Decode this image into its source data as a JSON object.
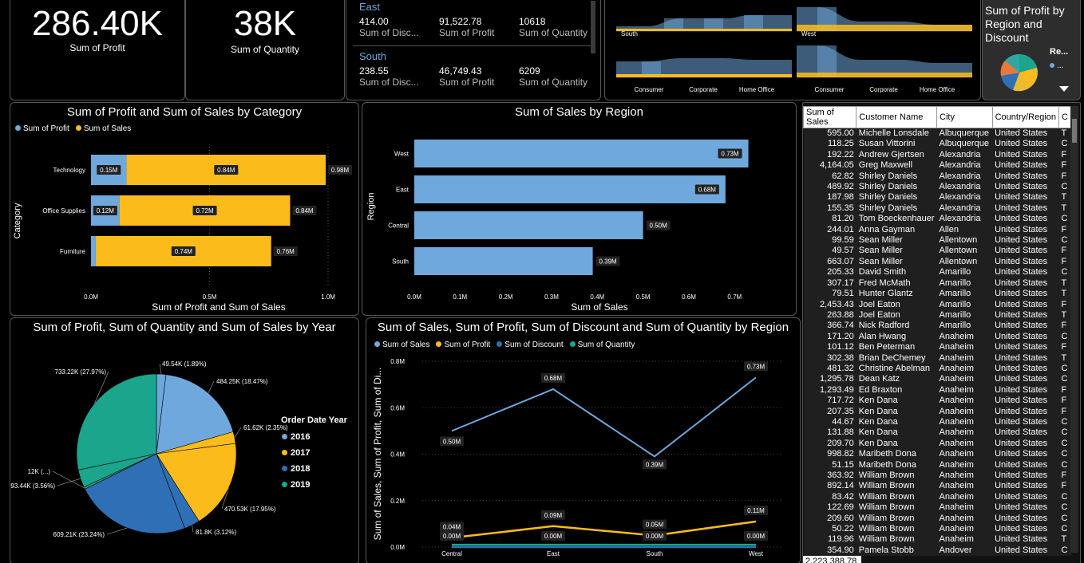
{
  "kpi": {
    "profit": {
      "value": "286.40K",
      "label": "Sum of Profit"
    },
    "quantity": {
      "value": "38K",
      "label": "Sum of Quantity"
    }
  },
  "multirow": [
    {
      "region": "East",
      "discount": "414.00",
      "discount_label": "Sum of Disc...",
      "profit": "91,522.78",
      "profit_label": "Sum of Profit",
      "quantity": "10618",
      "quantity_label": "Sum of Quantity"
    },
    {
      "region": "South",
      "discount": "238.55",
      "discount_label": "Sum of Disc...",
      "profit": "46,749.43",
      "profit_label": "Sum of Profit",
      "quantity": "6209",
      "quantity_label": "Sum of Quantity"
    }
  ],
  "ribbon": {
    "panels": [
      "South",
      "West"
    ],
    "segments": [
      "Consumer",
      "Corporate",
      "Home Office"
    ]
  },
  "piecard": {
    "title": "Sum of Profit by Region and Discount",
    "legend_title": "Re...",
    "legend_item": "...",
    "more_icon": "chevron-down-icon"
  },
  "colors": {
    "blue": "#6fa8dc",
    "yellow": "#fbbc1b",
    "darkblue": "#2f6fb5",
    "teal": "#1aa58c"
  },
  "chart_data": [
    {
      "type": "bar",
      "title": "Sum of Profit and Sum of Sales by Category",
      "xlabel": "Sum of Profit and Sum of Sales",
      "ylabel": "Category",
      "categories": [
        "Technology",
        "Office Supplies",
        "Furniture"
      ],
      "series": [
        {
          "name": "Sum of Profit",
          "values": [
            0.15,
            0.12,
            0.02
          ],
          "labels": [
            "0.15M",
            "0.12M",
            ""
          ]
        },
        {
          "name": "Sum of Sales",
          "values": [
            0.84,
            0.72,
            0.74
          ],
          "labels": [
            "0.84M",
            "0.72M",
            "0.74M"
          ]
        }
      ],
      "totals": [
        "0.98M",
        "0.84M",
        "0.76M"
      ],
      "xticks": [
        "0.0M",
        "0.5M",
        "1.0M"
      ],
      "xlim": [
        0,
        1.0
      ],
      "stacked": true,
      "legend": "top-left"
    },
    {
      "type": "bar",
      "title": "Sum of Sales by Region",
      "xlabel": "Sum of Sales",
      "ylabel": "Region",
      "categories": [
        "West",
        "East",
        "Central",
        "South"
      ],
      "values": [
        0.73,
        0.68,
        0.5,
        0.39
      ],
      "labels": [
        "0.73M",
        "0.68M",
        "0.50M",
        "0.39M"
      ],
      "xticks": [
        "0.0M",
        "0.1M",
        "0.2M",
        "0.3M",
        "0.4M",
        "0.5M",
        "0.6M",
        "0.7M"
      ],
      "xlim": [
        0,
        0.75
      ]
    },
    {
      "type": "pie",
      "title": "Sum of Profit, Sum of Quantity and Sum of Sales by Year",
      "legend_title": "Order Date Year",
      "legend": [
        "2016",
        "2017",
        "2018",
        "2019"
      ],
      "slices": [
        {
          "year": "2016",
          "value": 49.54,
          "label": "49.54K (1.89%)"
        },
        {
          "year": "2016",
          "value": 484.25,
          "label": "484.25K (18.47%)"
        },
        {
          "year": "2017",
          "value": 61.62,
          "label": "61.62K (2.35%)"
        },
        {
          "year": "2017",
          "value": 470.53,
          "label": "470.53K (17.95%)"
        },
        {
          "year": "2018",
          "value": 81.8,
          "label": "81.8K (3.12%)"
        },
        {
          "year": "2018",
          "value": 609.21,
          "label": "609.21K (23.24%)"
        },
        {
          "year": "2019",
          "value": 12,
          "label": "12K (...)"
        },
        {
          "year": "2019",
          "value": 93.44,
          "label": "93.44K (3.56%)"
        },
        {
          "year": "2019",
          "value": 733.22,
          "label": "733.22K (27.97%)"
        }
      ]
    },
    {
      "type": "line",
      "title": "Sum of Sales, Sum of Profit, Sum of Discount and Sum of Quantity by Region",
      "ylabel": "Sum of Sales, Sum of Profit, Sum of Di...",
      "x": [
        "Central",
        "East",
        "South",
        "West"
      ],
      "series": [
        {
          "name": "Sum of Sales",
          "values": [
            0.5,
            0.68,
            0.39,
            0.73
          ],
          "labels": [
            "0.50M",
            "0.68M",
            "0.39M",
            "0.73M"
          ]
        },
        {
          "name": "Sum of Profit",
          "values": [
            0.04,
            0.09,
            0.05,
            0.11
          ],
          "labels": [
            "0.04M",
            "0.09M",
            "0.05M",
            "0.11M"
          ]
        },
        {
          "name": "Sum of Discount",
          "values": [
            0.0,
            0.0,
            0.0,
            0.0
          ],
          "labels": [
            "0.00M",
            "0.00M",
            "0.00M",
            "0.00M"
          ]
        },
        {
          "name": "Sum of Quantity",
          "values": [
            0.01,
            0.01,
            0.01,
            0.01
          ],
          "labels": []
        }
      ],
      "yticks": [
        "0.0M",
        "0.2M",
        "0.4M",
        "0.6M",
        "0.8M"
      ],
      "ylim": [
        0,
        0.8
      ]
    }
  ],
  "table": {
    "columns": [
      "Sum of Sales",
      "Customer Name",
      "City",
      "Country/Region",
      "C"
    ],
    "rows": [
      [
        "595.00",
        "Michelle Lonsdale",
        "Albuquerque",
        "United States",
        "T"
      ],
      [
        "118.25",
        "Susan Vittorini",
        "Albuquerque",
        "United States",
        "C"
      ],
      [
        "192.22",
        "Andrew Gjertsen",
        "Alexandria",
        "United States",
        "F"
      ],
      [
        "4,164.05",
        "Greg Maxwell",
        "Alexandria",
        "United States",
        "F"
      ],
      [
        "62.82",
        "Shirley Daniels",
        "Alexandria",
        "United States",
        "F"
      ],
      [
        "489.92",
        "Shirley Daniels",
        "Alexandria",
        "United States",
        "C"
      ],
      [
        "187.98",
        "Shirley Daniels",
        "Alexandria",
        "United States",
        "T"
      ],
      [
        "155.35",
        "Shirley Daniels",
        "Alexandria",
        "United States",
        "T"
      ],
      [
        "81.20",
        "Tom Boeckenhauer",
        "Alexandria",
        "United States",
        "C"
      ],
      [
        "244.01",
        "Anna Gayman",
        "Allen",
        "United States",
        "F"
      ],
      [
        "99.59",
        "Sean Miller",
        "Allentown",
        "United States",
        "C"
      ],
      [
        "49.57",
        "Sean Miller",
        "Allentown",
        "United States",
        "F"
      ],
      [
        "663.07",
        "Sean Miller",
        "Allentown",
        "United States",
        "F"
      ],
      [
        "205.33",
        "David Smith",
        "Amarillo",
        "United States",
        "C"
      ],
      [
        "307.17",
        "Fred McMath",
        "Amarillo",
        "United States",
        "T"
      ],
      [
        "79.51",
        "Hunter Glantz",
        "Amarillo",
        "United States",
        "T"
      ],
      [
        "2,453.43",
        "Joel Eaton",
        "Amarillo",
        "United States",
        "F"
      ],
      [
        "263.88",
        "Joel Eaton",
        "Amarillo",
        "United States",
        "T"
      ],
      [
        "366.74",
        "Nick Radford",
        "Amarillo",
        "United States",
        "F"
      ],
      [
        "171.20",
        "Alan Hwang",
        "Anaheim",
        "United States",
        "C"
      ],
      [
        "101.12",
        "Ben Peterman",
        "Anaheim",
        "United States",
        "F"
      ],
      [
        "302.38",
        "Brian DeChemey",
        "Anaheim",
        "United States",
        "T"
      ],
      [
        "481.32",
        "Christine Abelman",
        "Anaheim",
        "United States",
        "C"
      ],
      [
        "1,295.78",
        "Dean Katz",
        "Anaheim",
        "United States",
        "C"
      ],
      [
        "1,293.49",
        "Ed Braxton",
        "Anaheim",
        "United States",
        "F"
      ],
      [
        "717.72",
        "Ken Dana",
        "Anaheim",
        "United States",
        "F"
      ],
      [
        "207.35",
        "Ken Dana",
        "Anaheim",
        "United States",
        "F"
      ],
      [
        "44.67",
        "Ken Dana",
        "Anaheim",
        "United States",
        "C"
      ],
      [
        "131.88",
        "Ken Dana",
        "Anaheim",
        "United States",
        "C"
      ],
      [
        "209.70",
        "Ken Dana",
        "Anaheim",
        "United States",
        "C"
      ],
      [
        "998.82",
        "Maribeth Dona",
        "Anaheim",
        "United States",
        "C"
      ],
      [
        "51.15",
        "Maribeth Dona",
        "Anaheim",
        "United States",
        "C"
      ],
      [
        "363.92",
        "William Brown",
        "Anaheim",
        "United States",
        "F"
      ],
      [
        "892.14",
        "William Brown",
        "Anaheim",
        "United States",
        "F"
      ],
      [
        "83.42",
        "William Brown",
        "Anaheim",
        "United States",
        "C"
      ],
      [
        "122.69",
        "William Brown",
        "Anaheim",
        "United States",
        "C"
      ],
      [
        "209.60",
        "William Brown",
        "Anaheim",
        "United States",
        "C"
      ],
      [
        "50.22",
        "William Brown",
        "Anaheim",
        "United States",
        "C"
      ],
      [
        "119.96",
        "William Brown",
        "Anaheim",
        "United States",
        "T"
      ],
      [
        "354.90",
        "Pamela Stobb",
        "Andover",
        "United States",
        "C"
      ]
    ],
    "total": "2,223,388.78"
  }
}
